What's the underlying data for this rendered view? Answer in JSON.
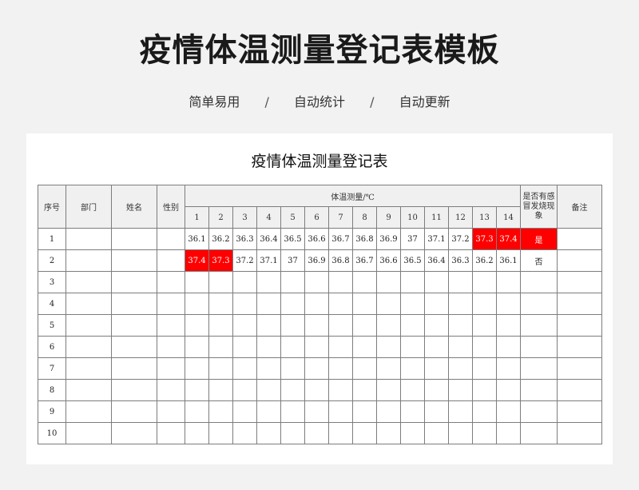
{
  "page": {
    "title": "疫情体温测量登记表模板",
    "features": [
      "简单易用",
      "自动统计",
      "自动更新"
    ],
    "separator": "/"
  },
  "sheet": {
    "title": "疫情体温测量登记表",
    "headers": {
      "seq": "序号",
      "dept": "部门",
      "name": "姓名",
      "gender": "性别",
      "temp_group": "体温测量/℃",
      "fever": "是否有感冒发烧现象",
      "notes": "备注"
    },
    "days": [
      "1",
      "2",
      "3",
      "4",
      "5",
      "6",
      "7",
      "8",
      "9",
      "10",
      "11",
      "12",
      "13",
      "14"
    ],
    "highlight_color": "#ff0000",
    "rows": [
      {
        "seq": "1",
        "dept": "",
        "name": "",
        "gender": "",
        "temps": [
          "36.1",
          "36.2",
          "36.3",
          "36.4",
          "36.5",
          "36.6",
          "36.7",
          "36.8",
          "36.9",
          "37",
          "37.1",
          "37.2",
          "37.3",
          "37.4"
        ],
        "hot": [
          12,
          13
        ],
        "fever": "是",
        "fever_hot": true,
        "notes": ""
      },
      {
        "seq": "2",
        "dept": "",
        "name": "",
        "gender": "",
        "temps": [
          "37.4",
          "37.3",
          "37.2",
          "37.1",
          "37",
          "36.9",
          "36.8",
          "36.7",
          "36.6",
          "36.5",
          "36.4",
          "36.3",
          "36.2",
          "36.1"
        ],
        "hot": [
          0,
          1
        ],
        "fever": "否",
        "fever_hot": false,
        "notes": ""
      },
      {
        "seq": "3",
        "temps": [],
        "hot": [],
        "fever": "",
        "fever_hot": false
      },
      {
        "seq": "4",
        "temps": [],
        "hot": [],
        "fever": "",
        "fever_hot": false
      },
      {
        "seq": "5",
        "temps": [],
        "hot": [],
        "fever": "",
        "fever_hot": false
      },
      {
        "seq": "6",
        "temps": [],
        "hot": [],
        "fever": "",
        "fever_hot": false
      },
      {
        "seq": "7",
        "temps": [],
        "hot": [],
        "fever": "",
        "fever_hot": false
      },
      {
        "seq": "8",
        "temps": [],
        "hot": [],
        "fever": "",
        "fever_hot": false
      },
      {
        "seq": "9",
        "temps": [],
        "hot": [],
        "fever": "",
        "fever_hot": false
      },
      {
        "seq": "10",
        "temps": [],
        "hot": [],
        "fever": "",
        "fever_hot": false
      }
    ]
  }
}
